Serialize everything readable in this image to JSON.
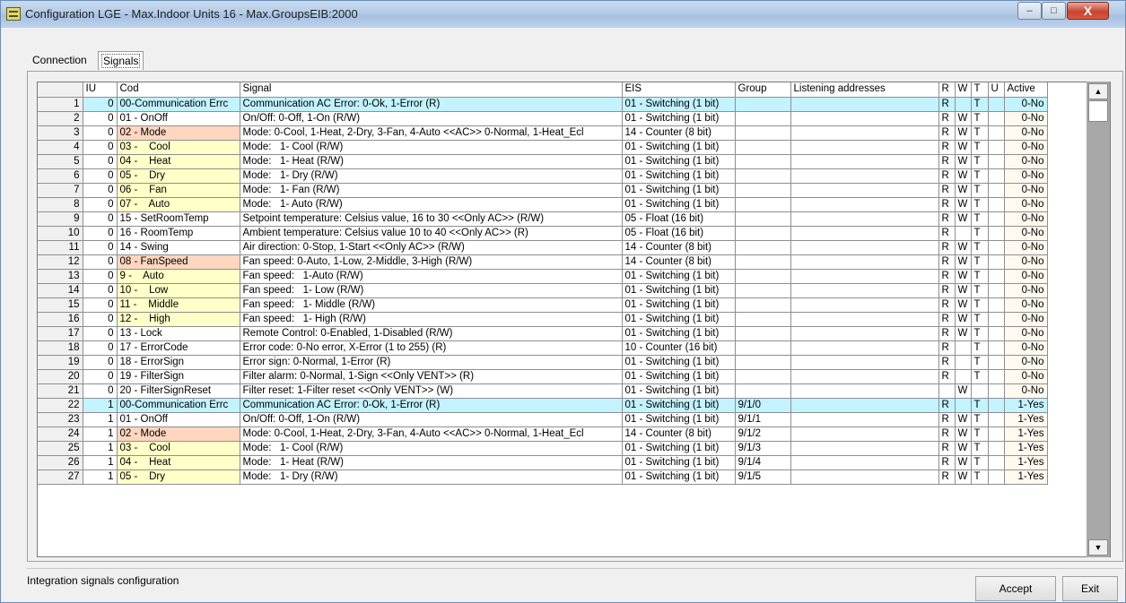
{
  "window": {
    "title": "Configuration LGE - Max.Indoor Units 16 - Max.GroupsEIB:2000",
    "minimize": "–",
    "maximize": "□",
    "close": "X"
  },
  "tabs": [
    {
      "label": "Connection"
    },
    {
      "label": "Signals"
    }
  ],
  "grid": {
    "columns": [
      "",
      "IU",
      "Cod",
      "Signal",
      "EIS",
      "Group",
      "Listening addresses",
      "R",
      "W",
      "T",
      "U",
      "Active"
    ],
    "rows": [
      {
        "n": "1",
        "iu": "0",
        "cod": "00-Communication Errc",
        "signal": "Communication AC Error: 0-Ok, 1-Error (R)",
        "eis": "01 - Switching (1 bit)",
        "group": "",
        "listen": "",
        "r": "R",
        "w": "",
        "t": "T",
        "u": "",
        "active": "0-No"
      },
      {
        "n": "2",
        "iu": "0",
        "cod": "01 - OnOff",
        "signal": "On/Off: 0-Off, 1-On (R/W)",
        "eis": "01 - Switching (1 bit)",
        "group": "",
        "listen": "",
        "r": "R",
        "w": "W",
        "t": "T",
        "u": "",
        "active": "0-No"
      },
      {
        "n": "3",
        "iu": "0",
        "cod": "02 - Mode",
        "signal": "Mode: 0-Cool, 1-Heat, 2-Dry, 3-Fan, 4-Auto <<AC>> 0-Normal, 1-Heat_Ecl",
        "eis": "14 - Counter (8 bit)",
        "group": "",
        "listen": "",
        "r": "R",
        "w": "W",
        "t": "T",
        "u": "",
        "active": "0-No"
      },
      {
        "n": "4",
        "iu": "0",
        "cod": "03 -    Cool",
        "signal": "Mode:   1- Cool (R/W)",
        "eis": "01 - Switching (1 bit)",
        "group": "",
        "listen": "",
        "r": "R",
        "w": "W",
        "t": "T",
        "u": "",
        "active": "0-No"
      },
      {
        "n": "5",
        "iu": "0",
        "cod": "04 -    Heat",
        "signal": "Mode:   1- Heat (R/W)",
        "eis": "01 - Switching (1 bit)",
        "group": "",
        "listen": "",
        "r": "R",
        "w": "W",
        "t": "T",
        "u": "",
        "active": "0-No"
      },
      {
        "n": "6",
        "iu": "0",
        "cod": "05 -    Dry",
        "signal": "Mode:   1- Dry (R/W)",
        "eis": "01 - Switching (1 bit)",
        "group": "",
        "listen": "",
        "r": "R",
        "w": "W",
        "t": "T",
        "u": "",
        "active": "0-No"
      },
      {
        "n": "7",
        "iu": "0",
        "cod": "06 -    Fan",
        "signal": "Mode:   1- Fan (R/W)",
        "eis": "01 - Switching (1 bit)",
        "group": "",
        "listen": "",
        "r": "R",
        "w": "W",
        "t": "T",
        "u": "",
        "active": "0-No"
      },
      {
        "n": "8",
        "iu": "0",
        "cod": "07 -    Auto",
        "signal": "Mode:   1- Auto (R/W)",
        "eis": "01 - Switching (1 bit)",
        "group": "",
        "listen": "",
        "r": "R",
        "w": "W",
        "t": "T",
        "u": "",
        "active": "0-No"
      },
      {
        "n": "9",
        "iu": "0",
        "cod": "15 - SetRoomTemp",
        "signal": "Setpoint temperature: Celsius value, 16 to 30 <<Only AC>> (R/W)",
        "eis": "05 - Float (16 bit)",
        "group": "",
        "listen": "",
        "r": "R",
        "w": "W",
        "t": "T",
        "u": "",
        "active": "0-No"
      },
      {
        "n": "10",
        "iu": "0",
        "cod": "16 - RoomTemp",
        "signal": "Ambient temperature: Celsius value 10 to 40 <<Only AC>> (R)",
        "eis": "05 - Float (16 bit)",
        "group": "",
        "listen": "",
        "r": "R",
        "w": "",
        "t": "T",
        "u": "",
        "active": "0-No"
      },
      {
        "n": "11",
        "iu": "0",
        "cod": "14 - Swing",
        "signal": "Air direction: 0-Stop, 1-Start <<Only AC>> (R/W)",
        "eis": "14 - Counter (8 bit)",
        "group": "",
        "listen": "",
        "r": "R",
        "w": "W",
        "t": "T",
        "u": "",
        "active": "0-No"
      },
      {
        "n": "12",
        "iu": "0",
        "cod": "08 - FanSpeed",
        "signal": "Fan speed: 0-Auto, 1-Low, 2-Middle, 3-High (R/W)",
        "eis": "14 - Counter (8 bit)",
        "group": "",
        "listen": "",
        "r": "R",
        "w": "W",
        "t": "T",
        "u": "",
        "active": "0-No"
      },
      {
        "n": "13",
        "iu": "0",
        "cod": "9 -    Auto",
        "signal": "Fan speed:   1-Auto (R/W)",
        "eis": "01 - Switching (1 bit)",
        "group": "",
        "listen": "",
        "r": "R",
        "w": "W",
        "t": "T",
        "u": "",
        "active": "0-No"
      },
      {
        "n": "14",
        "iu": "0",
        "cod": "10 -    Low",
        "signal": "Fan speed:   1- Low (R/W)",
        "eis": "01 - Switching (1 bit)",
        "group": "",
        "listen": "",
        "r": "R",
        "w": "W",
        "t": "T",
        "u": "",
        "active": "0-No"
      },
      {
        "n": "15",
        "iu": "0",
        "cod": "11 -    Middle",
        "signal": "Fan speed:   1- Middle (R/W)",
        "eis": "01 - Switching (1 bit)",
        "group": "",
        "listen": "",
        "r": "R",
        "w": "W",
        "t": "T",
        "u": "",
        "active": "0-No"
      },
      {
        "n": "16",
        "iu": "0",
        "cod": "12 -    High",
        "signal": "Fan speed:   1- High (R/W)",
        "eis": "01 - Switching (1 bit)",
        "group": "",
        "listen": "",
        "r": "R",
        "w": "W",
        "t": "T",
        "u": "",
        "active": "0-No"
      },
      {
        "n": "17",
        "iu": "0",
        "cod": "13 - Lock",
        "signal": "Remote Control: 0-Enabled, 1-Disabled (R/W)",
        "eis": "01 - Switching (1 bit)",
        "group": "",
        "listen": "",
        "r": "R",
        "w": "W",
        "t": "T",
        "u": "",
        "active": "0-No"
      },
      {
        "n": "18",
        "iu": "0",
        "cod": "17 - ErrorCode",
        "signal": "Error code: 0-No error, X-Error (1 to 255) (R)",
        "eis": "10 - Counter (16 bit)",
        "group": "",
        "listen": "",
        "r": "R",
        "w": "",
        "t": "T",
        "u": "",
        "active": "0-No"
      },
      {
        "n": "19",
        "iu": "0",
        "cod": "18 - ErrorSign",
        "signal": "Error sign: 0-Normal, 1-Error (R)",
        "eis": "01 - Switching (1 bit)",
        "group": "",
        "listen": "",
        "r": "R",
        "w": "",
        "t": "T",
        "u": "",
        "active": "0-No"
      },
      {
        "n": "20",
        "iu": "0",
        "cod": "19 - FilterSign",
        "signal": "Filter alarm: 0-Normal, 1-Sign <<Only VENT>> (R)",
        "eis": "01 - Switching (1 bit)",
        "group": "",
        "listen": "",
        "r": "R",
        "w": "",
        "t": "T",
        "u": "",
        "active": "0-No"
      },
      {
        "n": "21",
        "iu": "0",
        "cod": "20 - FilterSignReset",
        "signal": "Filter reset: 1-Filter reset <<Only VENT>> (W)",
        "eis": "01 - Switching (1 bit)",
        "group": "",
        "listen": "",
        "r": "",
        "w": "W",
        "t": "",
        "u": "",
        "active": "0-No"
      },
      {
        "n": "22",
        "iu": "1",
        "cod": "00-Communication Errc",
        "signal": "Communication AC Error: 0-Ok, 1-Error (R)",
        "eis": "01 - Switching (1 bit)",
        "group": "9/1/0",
        "listen": "",
        "r": "R",
        "w": "",
        "t": "T",
        "u": "",
        "active": "1-Yes"
      },
      {
        "n": "23",
        "iu": "1",
        "cod": "01 - OnOff",
        "signal": "On/Off: 0-Off, 1-On (R/W)",
        "eis": "01 - Switching (1 bit)",
        "group": "9/1/1",
        "listen": "",
        "r": "R",
        "w": "W",
        "t": "T",
        "u": "",
        "active": "1-Yes"
      },
      {
        "n": "24",
        "iu": "1",
        "cod": "02 - Mode",
        "signal": "Mode: 0-Cool, 1-Heat, 2-Dry, 3-Fan, 4-Auto <<AC>> 0-Normal, 1-Heat_Ecl",
        "eis": "14 - Counter (8 bit)",
        "group": "9/1/2",
        "listen": "",
        "r": "R",
        "w": "W",
        "t": "T",
        "u": "",
        "active": "1-Yes"
      },
      {
        "n": "25",
        "iu": "1",
        "cod": "03 -    Cool",
        "signal": "Mode:   1- Cool (R/W)",
        "eis": "01 - Switching (1 bit)",
        "group": "9/1/3",
        "listen": "",
        "r": "R",
        "w": "W",
        "t": "T",
        "u": "",
        "active": "1-Yes"
      },
      {
        "n": "26",
        "iu": "1",
        "cod": "04 -    Heat",
        "signal": "Mode:   1- Heat (R/W)",
        "eis": "01 - Switching (1 bit)",
        "group": "9/1/4",
        "listen": "",
        "r": "R",
        "w": "W",
        "t": "T",
        "u": "",
        "active": "1-Yes"
      },
      {
        "n": "27",
        "iu": "1",
        "cod": "05 -    Dry",
        "signal": "Mode:   1- Dry (R/W)",
        "eis": "01 - Switching (1 bit)",
        "group": "9/1/5",
        "listen": "",
        "r": "R",
        "w": "W",
        "t": "T",
        "u": "",
        "active": "1-Yes"
      }
    ]
  },
  "status": {
    "text": "Integration signals configuration"
  },
  "buttons": {
    "accept": "Accept",
    "exit": "Exit"
  },
  "colors": {
    "highlight_row": "#c2f3ff",
    "cod_orange": "#ffd6c0",
    "cod_yellow": "#ffffc8",
    "active_cell": "#fff9ef"
  }
}
